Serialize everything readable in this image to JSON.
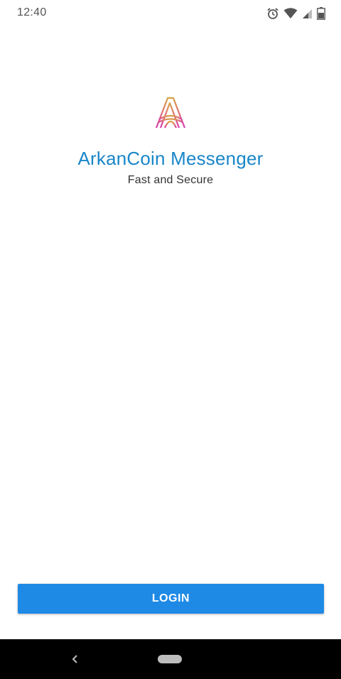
{
  "status_bar": {
    "time": "12:40",
    "icons": [
      "alarm-icon",
      "wifi-icon",
      "cell-signal-icon",
      "battery-icon"
    ]
  },
  "app": {
    "title": "ArkanCoin Messenger",
    "subtitle": "Fast and Secure",
    "logo_icon": "arkancoin-logo-icon",
    "title_color": "#1a86c8"
  },
  "login": {
    "label": "LOGIN",
    "color": "#1e8ae6"
  },
  "nav_bar": {
    "icons": [
      "back-icon",
      "home-pill-icon"
    ]
  }
}
